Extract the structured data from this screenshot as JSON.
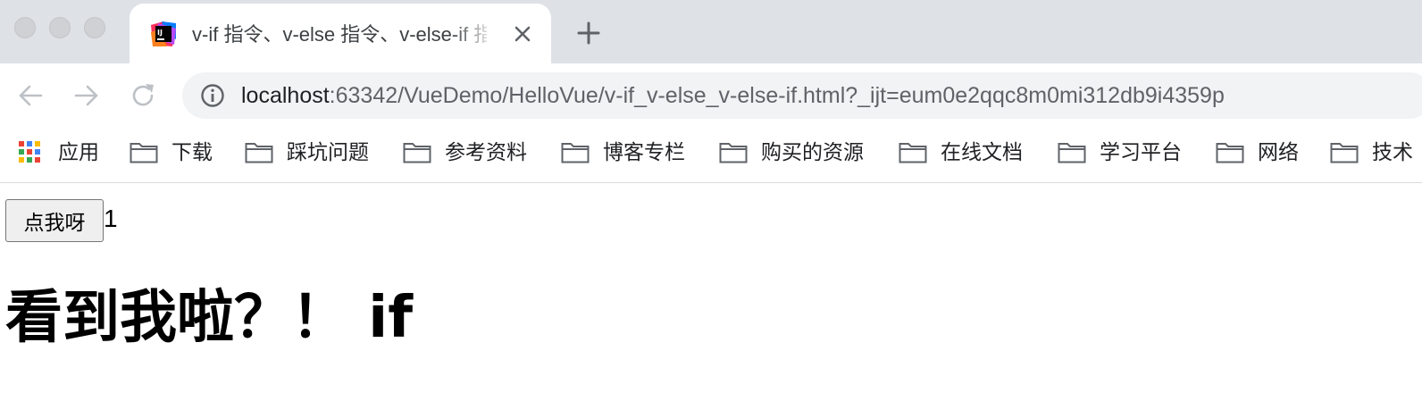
{
  "window": {
    "controls": [
      "close",
      "minimize",
      "zoom"
    ]
  },
  "tab": {
    "title": "v-if 指令、v-else 指令、v-else-if 指令",
    "favicon": "intellij-idea-icon"
  },
  "toolbar": {
    "url_host": "localhost",
    "url_rest": ":63342/VueDemo/HelloVue/v-if_v-else_v-else-if.html?_ijt=eum0e2qqc8m0mi312db9i4359p"
  },
  "bookmarks": {
    "apps_label": "应用",
    "folders": [
      "下载",
      "踩坑问题",
      "参考资料",
      "博客专栏",
      "购买的资源",
      "在线文档",
      "学习平台",
      "网络",
      "技术"
    ]
  },
  "page": {
    "button_label": "点我呀",
    "counter": "1",
    "heading": "看到我啦？！ if"
  },
  "colors": {
    "tabstrip_bg": "#dee1e6",
    "omnibox_bg": "#f1f3f4",
    "folder_gray": "#5f6368"
  }
}
